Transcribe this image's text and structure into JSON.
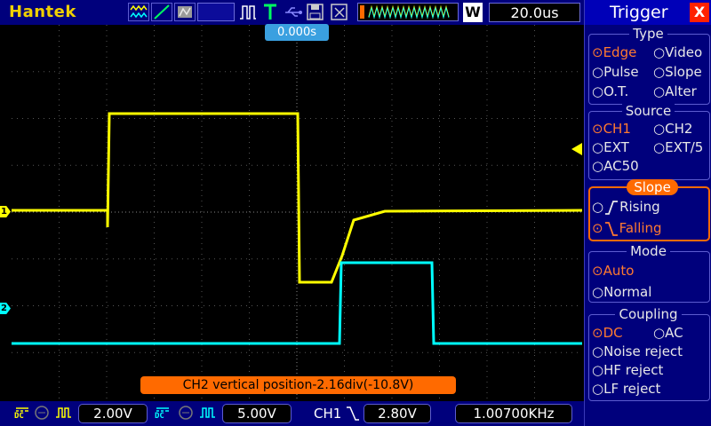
{
  "brand": "Hantek",
  "timebase": "20.0us",
  "mode_badge": "W",
  "trigger_time": "0.000s",
  "status_message": "CH2 vertical position-2.16div(-10.8V)",
  "markers": {
    "ch1": "1",
    "ch2": "2"
  },
  "bottom": {
    "ch1_coupling": "DC",
    "ch1_volts": "2.00V",
    "ch2_coupling": "DC",
    "ch2_volts": "5.00V",
    "trigger_source": "CH1",
    "trigger_level": "2.80V",
    "frequency": "1.00700KHz"
  },
  "menu": {
    "title": "Trigger",
    "close": "X",
    "type": {
      "heading": "Type",
      "options": [
        "Edge",
        "Video",
        "Pulse",
        "Slope",
        "O.T.",
        "Alter"
      ],
      "selected": "Edge"
    },
    "source": {
      "heading": "Source",
      "options": [
        "CH1",
        "CH2",
        "EXT",
        "EXT/5",
        "AC50"
      ],
      "selected": "CH1"
    },
    "slope": {
      "heading": "Slope",
      "options": [
        "Rising",
        "Falling"
      ],
      "selected": "Falling"
    },
    "mode": {
      "heading": "Mode",
      "options": [
        "Auto",
        "Normal"
      ],
      "selected": "Auto"
    },
    "coupling": {
      "heading": "Coupling",
      "options": [
        "DC",
        "AC",
        "Noise reject",
        "HF reject",
        "LF reject"
      ],
      "selected": "DC"
    }
  },
  "colors": {
    "ch1": "#ffff00",
    "ch2": "#00ffff",
    "accent": "#ff6a00",
    "bar": "#00007c"
  }
}
